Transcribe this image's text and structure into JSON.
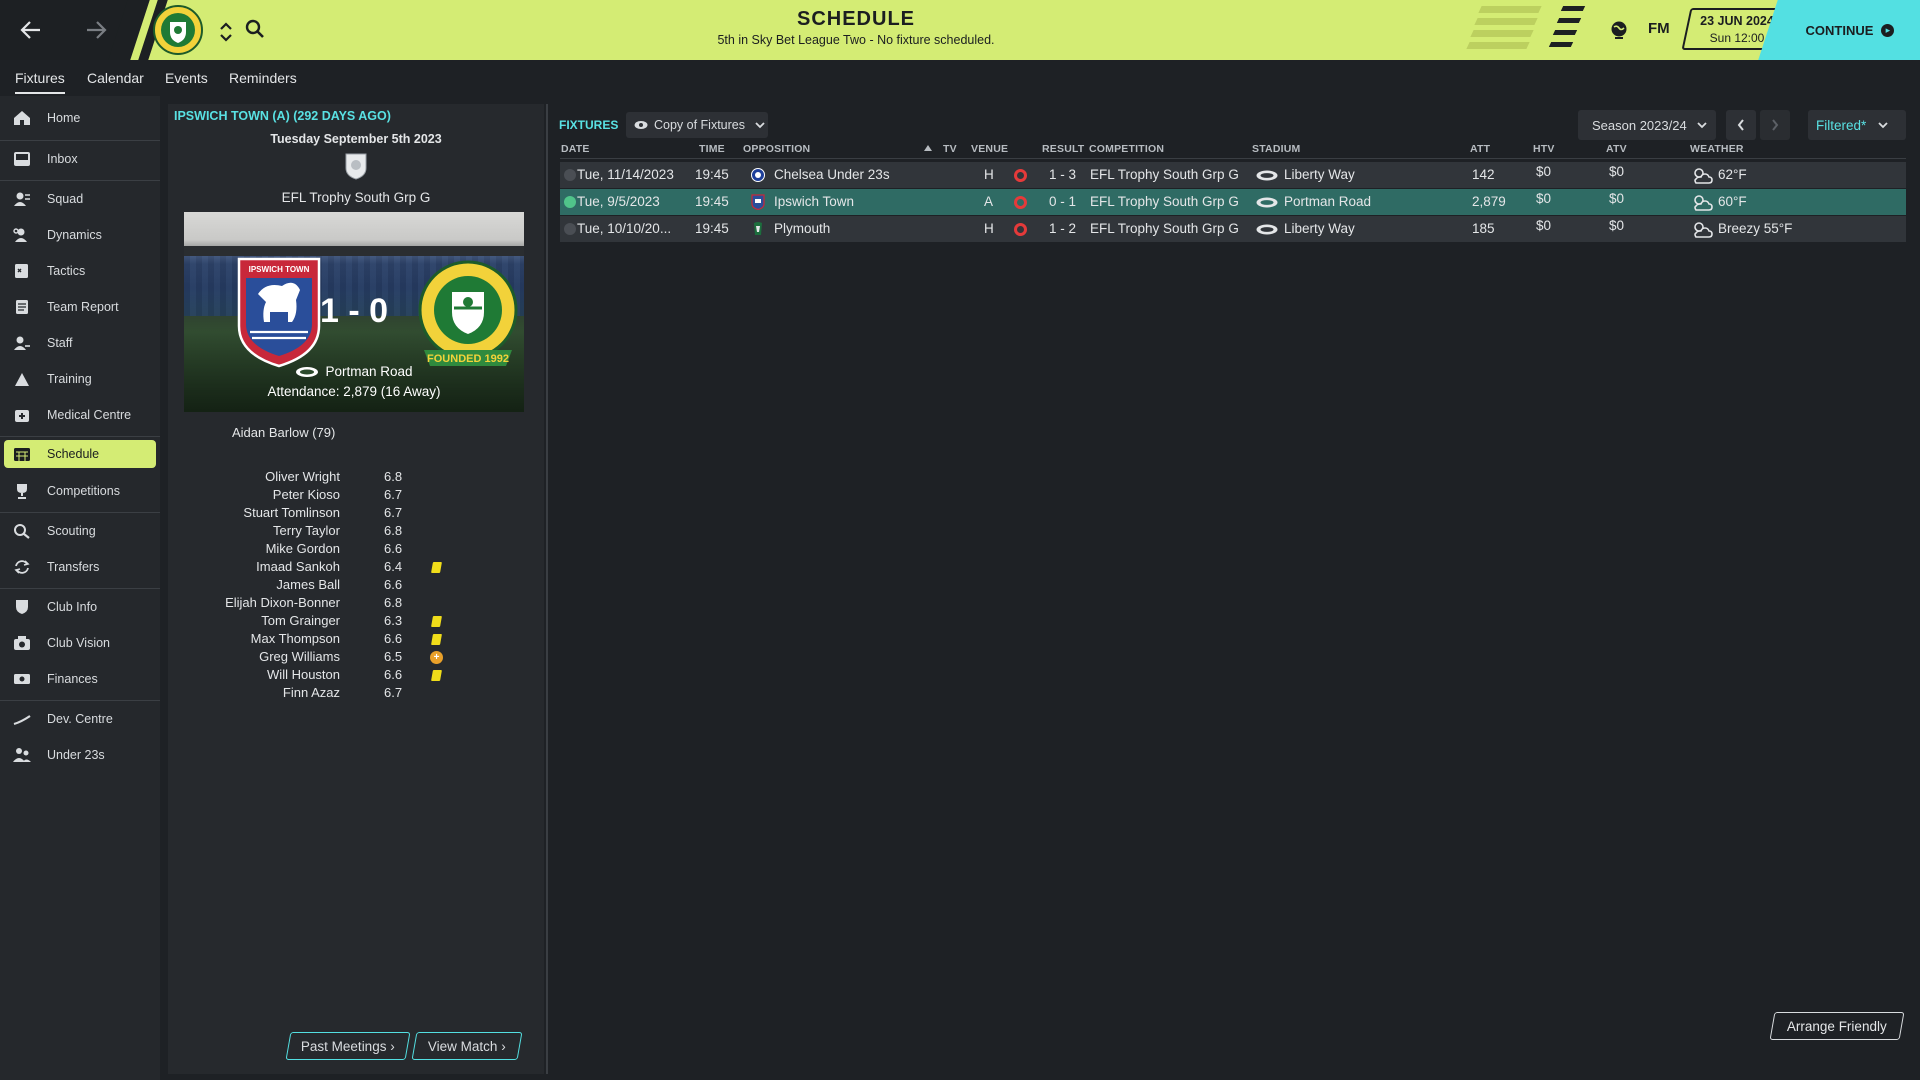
{
  "header": {
    "title": "SCHEDULE",
    "subtitle": "5th in Sky Bet League Two - No fixture scheduled.",
    "brand": "FM",
    "date_main": "23 JUN 2024",
    "date_sub": "Sun 12:00",
    "continue_label": "CONTINUE",
    "accent_color": "#d4ec74",
    "continue_color": "#53e0e2"
  },
  "subtabs": [
    "Fixtures",
    "Calendar",
    "Events",
    "Reminders"
  ],
  "sidebar": {
    "items": [
      {
        "label": "Home",
        "icon": "home-icon"
      },
      {
        "label": "Inbox",
        "icon": "inbox-icon"
      },
      {
        "label": "Squad",
        "icon": "squad-icon"
      },
      {
        "label": "Dynamics",
        "icon": "dynamics-icon"
      },
      {
        "label": "Tactics",
        "icon": "tactics-icon"
      },
      {
        "label": "Team Report",
        "icon": "report-icon"
      },
      {
        "label": "Staff",
        "icon": "staff-icon"
      },
      {
        "label": "Training",
        "icon": "training-icon"
      },
      {
        "label": "Medical Centre",
        "icon": "medical-icon"
      },
      {
        "label": "Schedule",
        "icon": "calendar-icon"
      },
      {
        "label": "Competitions",
        "icon": "trophy-icon"
      },
      {
        "label": "Scouting",
        "icon": "search-icon"
      },
      {
        "label": "Transfers",
        "icon": "transfer-icon"
      },
      {
        "label": "Club Info",
        "icon": "shield-icon"
      },
      {
        "label": "Club Vision",
        "icon": "vision-icon"
      },
      {
        "label": "Finances",
        "icon": "money-icon"
      },
      {
        "label": "Dev. Centre",
        "icon": "dev-icon"
      },
      {
        "label": "Under 23s",
        "icon": "group-icon"
      }
    ]
  },
  "match": {
    "heading": "IPSWICH TOWN (A) (292 DAYS AGO)",
    "date": "Tuesday September 5th 2023",
    "competition": "EFL Trophy South Grp G",
    "score": "1 - 0",
    "home_crest_text": "IPSWICH TOWN",
    "away_crest_text": "FOUNDED 1992",
    "stadium": "Portman Road",
    "attendance": "Attendance: 2,879 (16 Away)",
    "scorer": "Aidan Barlow (79)",
    "players": [
      {
        "name": "Oliver Wright",
        "rating": "6.8",
        "mark": ""
      },
      {
        "name": "Peter Kioso",
        "rating": "6.7",
        "mark": ""
      },
      {
        "name": "Stuart Tomlinson",
        "rating": "6.7",
        "mark": ""
      },
      {
        "name": "Terry Taylor",
        "rating": "6.8",
        "mark": ""
      },
      {
        "name": "Mike Gordon",
        "rating": "6.6",
        "mark": ""
      },
      {
        "name": "Imaad Sankoh",
        "rating": "6.4",
        "mark": "yellow"
      },
      {
        "name": "James Ball",
        "rating": "6.6",
        "mark": ""
      },
      {
        "name": "Elijah Dixon-Bonner",
        "rating": "6.8",
        "mark": ""
      },
      {
        "name": "Tom Grainger",
        "rating": "6.3",
        "mark": "yellow"
      },
      {
        "name": "Max Thompson",
        "rating": "6.6",
        "mark": "yellow"
      },
      {
        "name": "Greg Williams",
        "rating": "6.5",
        "mark": "sub"
      },
      {
        "name": "Will Houston",
        "rating": "6.6",
        "mark": "yellow"
      },
      {
        "name": "Finn Azaz",
        "rating": "6.7",
        "mark": ""
      }
    ],
    "past_meetings_label": "Past Meetings",
    "view_match_label": "View Match"
  },
  "fixtures": {
    "title": "FIXTURES",
    "view_label": "Copy of Fixtures",
    "season_label": "Season 2023/24",
    "filter_label": "Filtered*",
    "columns": {
      "date": "DATE",
      "time": "TIME",
      "opposition": "OPPOSITION",
      "tv": "TV",
      "venue": "VENUE",
      "result": "RESULT",
      "competition": "COMPETITION",
      "stadium": "STADIUM",
      "att": "ATT",
      "htv": "HTV",
      "atv": "ATV",
      "weather": "WEATHER"
    },
    "rows": [
      {
        "date": "Tue, 11/14/2023",
        "time": "19:45",
        "opposition": "Chelsea Under 23s",
        "venue": "H",
        "result": "1 - 3",
        "competition": "EFL Trophy South Grp G",
        "stadium": "Liberty Way",
        "att": "142",
        "htv": "$0",
        "atv": "$0",
        "weather": "62°F",
        "selected": false
      },
      {
        "date": "Tue, 9/5/2023",
        "time": "19:45",
        "opposition": "Ipswich Town",
        "venue": "A",
        "result": "0 - 1",
        "competition": "EFL Trophy South Grp G",
        "stadium": "Portman Road",
        "att": "2,879",
        "htv": "$0",
        "atv": "$0",
        "weather": "60°F",
        "selected": true
      },
      {
        "date": "Tue, 10/10/20...",
        "time": "19:45",
        "opposition": "Plymouth",
        "venue": "H",
        "result": "1 - 2",
        "competition": "EFL Trophy South Grp G",
        "stadium": "Liberty Way",
        "att": "185",
        "htv": "$0",
        "atv": "$0",
        "weather": "Breezy 55°F",
        "selected": false
      }
    ],
    "arrange_label": "Arrange Friendly"
  }
}
